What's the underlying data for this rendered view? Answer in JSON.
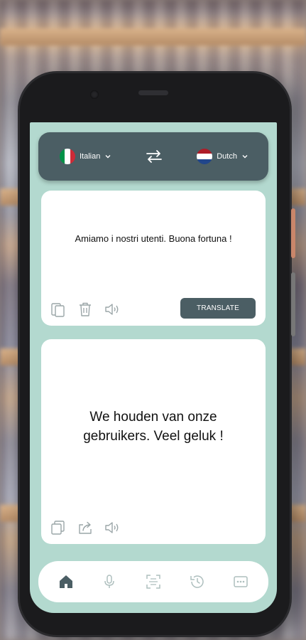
{
  "language_bar": {
    "source_language": "Italian",
    "target_language": "Dutch",
    "source_flag_colors": [
      "#009246",
      "#ffffff",
      "#ce2b37"
    ],
    "target_flag_colors": [
      "#ae1c28",
      "#ffffff",
      "#21468b"
    ]
  },
  "input_card": {
    "text": "Amiamo i nostri utenti. Buona fortuna !",
    "translate_label": "TRANSLATE",
    "tools": [
      "paste-icon",
      "trash-icon",
      "speaker-icon"
    ]
  },
  "output_card": {
    "text": "We houden van onze gebruikers. Veel geluk !",
    "tools": [
      "copy-icon",
      "share-icon",
      "speaker-icon"
    ]
  },
  "bottom_nav": {
    "items": [
      "home-icon",
      "microphone-icon",
      "scan-icon",
      "history-icon",
      "more-icon"
    ],
    "active": "home-icon"
  },
  "colors": {
    "accent": "#4b5e64",
    "app_background": "#b3d9cf",
    "card": "#ffffff",
    "nav_active": "#4b5e64",
    "nav_inactive": "#aebfbe"
  }
}
